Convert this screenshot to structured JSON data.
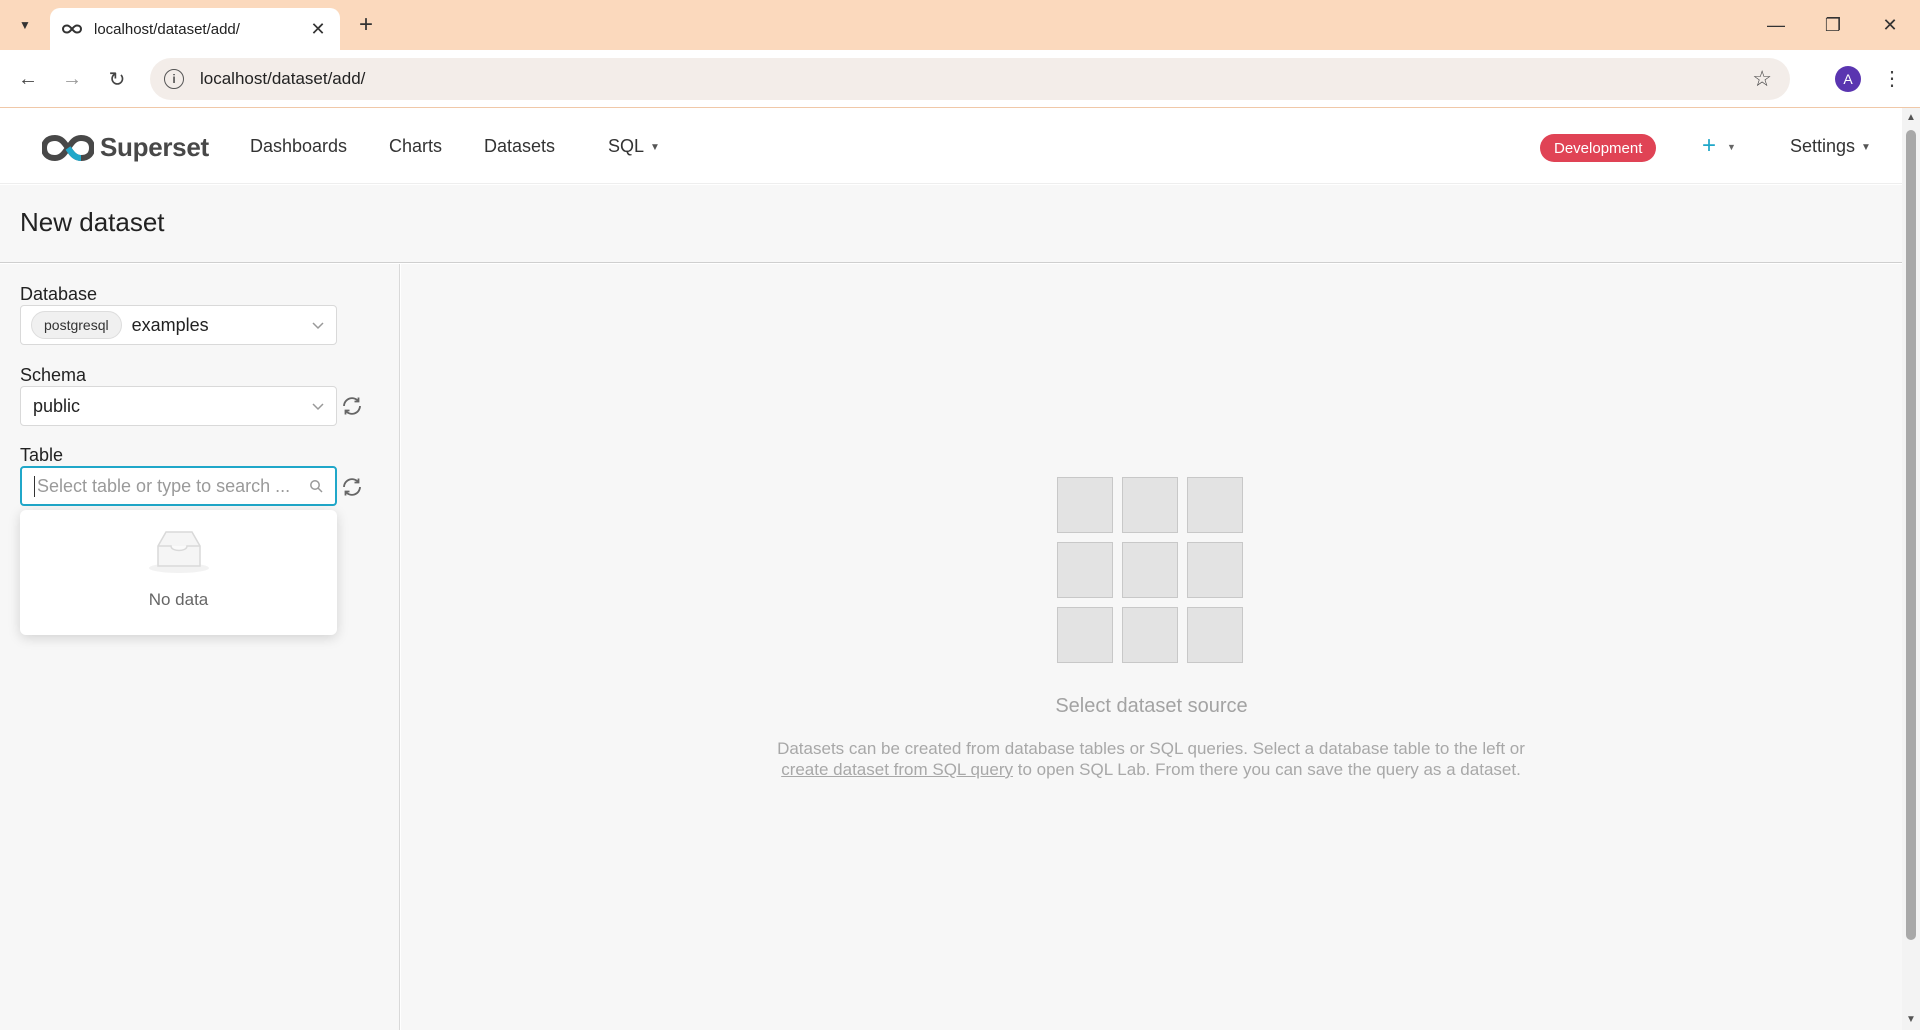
{
  "browser": {
    "tab_title": "localhost/dataset/add/",
    "url": "localhost/dataset/add/",
    "profile_initial": "A"
  },
  "header": {
    "brand": "Superset",
    "nav": [
      "Dashboards",
      "Charts",
      "Datasets",
      "SQL"
    ],
    "env_badge": "Development",
    "settings_label": "Settings",
    "accent_color": "#20a7c9",
    "badge_color": "#e04355"
  },
  "page": {
    "title": "New dataset"
  },
  "form": {
    "database_label": "Database",
    "database_tag": "postgresql",
    "database_value": "examples",
    "schema_label": "Schema",
    "schema_value": "public",
    "table_label": "Table",
    "table_placeholder": "Select table or type to search ...",
    "dropdown_empty": "No data"
  },
  "empty_state": {
    "title": "Select dataset source",
    "desc_before": "Datasets can be created from database tables or SQL queries. Select a database table to the left or ",
    "desc_link": "create dataset from SQL query",
    "desc_after": " to open SQL Lab. From there you can save the query as a dataset."
  }
}
